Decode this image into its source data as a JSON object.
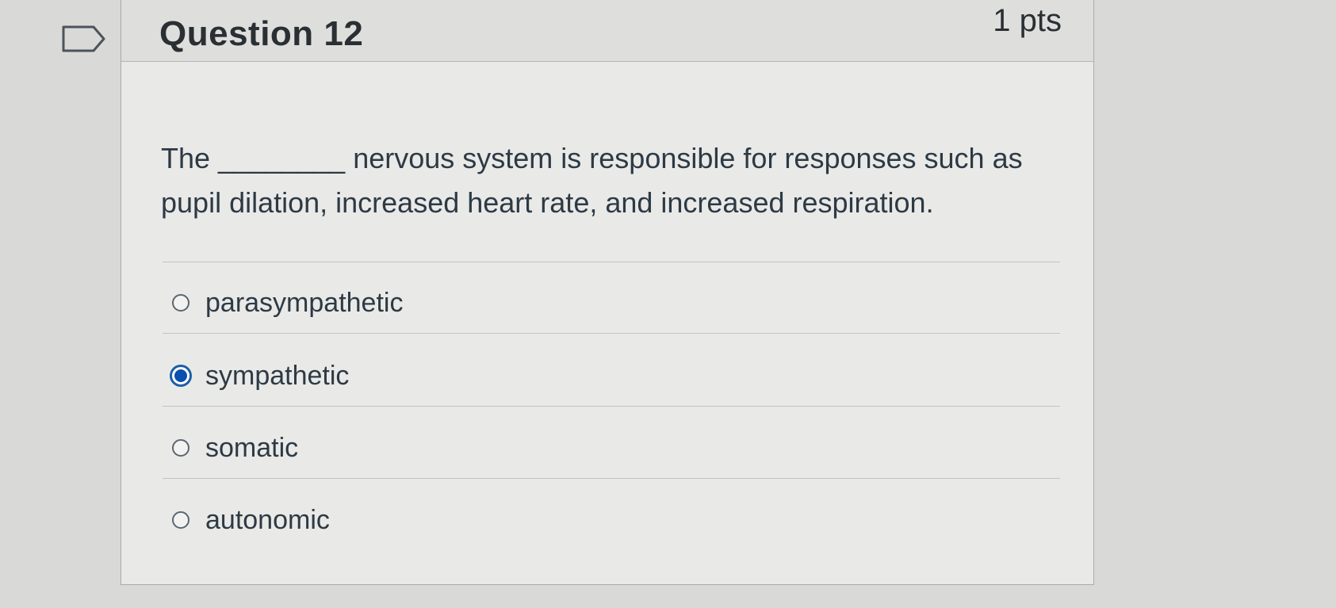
{
  "question": {
    "title": "Question 12",
    "points": "1 pts",
    "text": "The ________ nervous system is responsible for responses such as pupil dilation, increased heart rate, and increased respiration."
  },
  "answers": [
    {
      "label": "parasympathetic",
      "selected": false
    },
    {
      "label": "sympathetic",
      "selected": true
    },
    {
      "label": "somatic",
      "selected": false
    },
    {
      "label": "autonomic",
      "selected": false
    }
  ],
  "colors": {
    "selected_radio": "#0b4fb0",
    "background": "#d9d9d7",
    "text": "#2d3a44"
  },
  "icons": {
    "flag": "flag-question-icon"
  }
}
